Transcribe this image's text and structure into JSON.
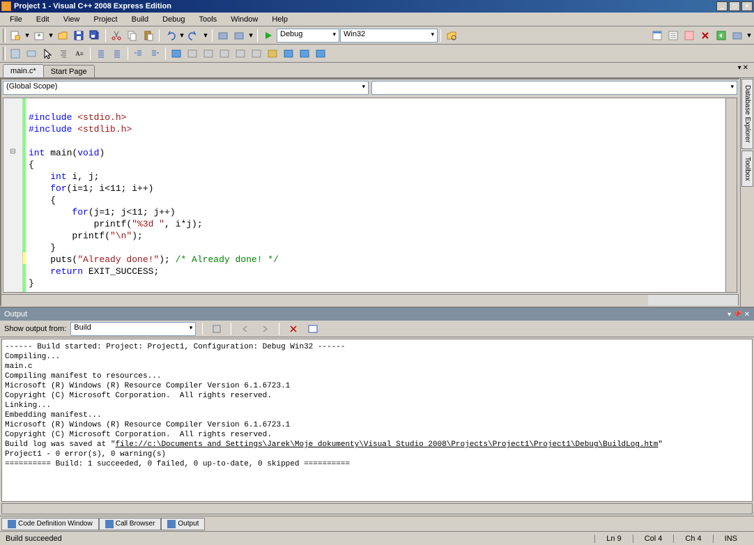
{
  "titlebar": {
    "title": "Project 1 - Visual C++ 2008 Express Edition"
  },
  "menubar": {
    "items": [
      "File",
      "Edit",
      "View",
      "Project",
      "Build",
      "Debug",
      "Tools",
      "Window",
      "Help"
    ]
  },
  "toolbar1": {
    "config": "Debug",
    "platform": "Win32"
  },
  "doc_tabs": {
    "items": [
      {
        "label": "main.c*",
        "active": true
      },
      {
        "label": "Start Page",
        "active": false
      }
    ]
  },
  "scope": {
    "left": "(Global Scope)",
    "right": ""
  },
  "side_tabs": {
    "items": [
      "Database Explorer",
      "Toolbox"
    ]
  },
  "code": {
    "lines": [
      {
        "t": "",
        "c": ""
      },
      {
        "t": "dir",
        "c": "#include <stdio.h>"
      },
      {
        "t": "dir",
        "c": "#include <stdlib.h>"
      },
      {
        "t": "",
        "c": ""
      },
      {
        "t": "fn",
        "c": "int main(void)"
      },
      {
        "t": "",
        "c": "{"
      },
      {
        "t": "kw",
        "c": "    int i, j;"
      },
      {
        "t": "for",
        "c": "    for(i=1; i<11; i++)"
      },
      {
        "t": "",
        "c": "    {"
      },
      {
        "t": "for2",
        "c": "        for(j=1; j<11; j++)"
      },
      {
        "t": "pr",
        "c": "            printf(\"%3d \", i*j);"
      },
      {
        "t": "pr2",
        "c": "        printf(\"\\n\");"
      },
      {
        "t": "",
        "c": "    }"
      },
      {
        "t": "puts",
        "c": "    puts(\"Already done!\"); /* Already done! */"
      },
      {
        "t": "ret",
        "c": "    return EXIT_SUCCESS;"
      },
      {
        "t": "",
        "c": "}"
      }
    ]
  },
  "output": {
    "title": "Output",
    "from_label": "Show output from:",
    "from_value": "Build",
    "text_lines": [
      "------ Build started: Project: Project1, Configuration: Debug Win32 ------",
      "Compiling...",
      "main.c",
      "Compiling manifest to resources...",
      "Microsoft (R) Windows (R) Resource Compiler Version 6.1.6723.1",
      "Copyright (C) Microsoft Corporation.  All rights reserved.",
      "Linking...",
      "Embedding manifest...",
      "Microsoft (R) Windows (R) Resource Compiler Version 6.1.6723.1",
      "Copyright (C) Microsoft Corporation.  All rights reserved."
    ],
    "log_prefix": "Build log was saved at \"",
    "log_url": "file://c:\\Documents and Settings\\Jarek\\Moje dokumenty\\Visual Studio 2008\\Projects\\Project1\\Project1\\Debug\\BuildLog.htm",
    "log_suffix": "\"",
    "result_line": "Project1 - 0 error(s), 0 warning(s)",
    "summary": "========== Build: 1 succeeded, 0 failed, 0 up-to-date, 0 skipped =========="
  },
  "bottom_tabs": {
    "items": [
      "Code Definition Window",
      "Call Browser",
      "Output"
    ]
  },
  "statusbar": {
    "message": "Build succeeded",
    "ln": "Ln 9",
    "col": "Col 4",
    "ch": "Ch 4",
    "ins": "INS"
  }
}
